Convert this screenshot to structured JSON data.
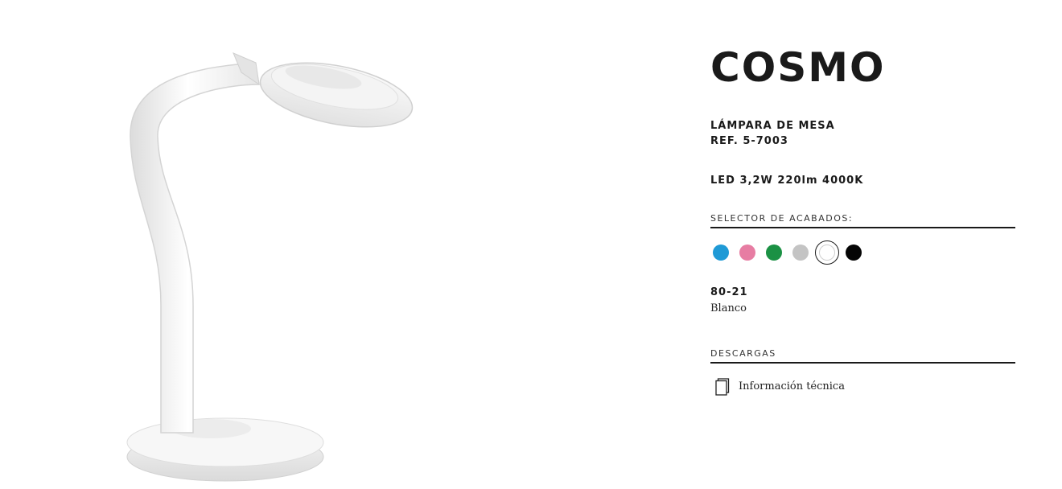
{
  "product": {
    "name": "COSMO",
    "type": "LÁMPARA DE MESA",
    "reference": "REF. 5-7003",
    "spec": "LED 3,2W 220lm 4000K"
  },
  "finish_selector": {
    "header": "SELECTOR DE ACABADOS:",
    "swatches": [
      {
        "color": "#1f9ad6",
        "icon": "color-swatch-blue"
      },
      {
        "color": "#e77da3",
        "icon": "color-swatch-pink"
      },
      {
        "color": "#1b9144",
        "icon": "color-swatch-green"
      },
      {
        "color": "#c4c4c4",
        "icon": "color-swatch-grey"
      },
      {
        "color": "#ffffff",
        "icon": "color-swatch-white",
        "selected": true
      },
      {
        "color": "#050505",
        "icon": "color-swatch-black"
      }
    ],
    "selected_code": "80-21",
    "selected_name": "Blanco"
  },
  "downloads": {
    "header": "DESCARGAS",
    "items": [
      {
        "label": "Información técnica",
        "icon": "document-icon"
      }
    ]
  }
}
